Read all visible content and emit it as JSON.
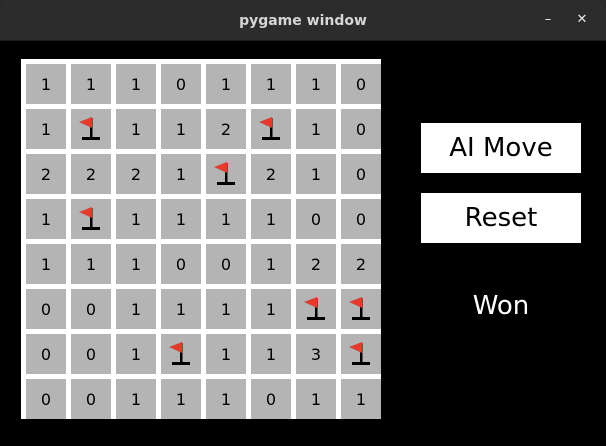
{
  "window": {
    "title": "pygame window",
    "minimize_glyph": "–",
    "close_glyph": "✕"
  },
  "board": {
    "rows": 8,
    "cols": 8,
    "cell_color": "#b4b4b4",
    "grid_color": "#ffffff",
    "flag_color": "#e8392b",
    "cells": [
      [
        "1",
        "1",
        "1",
        "0",
        "1",
        "1",
        "1",
        "0"
      ],
      [
        "1",
        "F",
        "1",
        "1",
        "2",
        "F",
        "1",
        "0"
      ],
      [
        "2",
        "2",
        "2",
        "1",
        "F",
        "2",
        "1",
        "0"
      ],
      [
        "1",
        "F",
        "1",
        "1",
        "1",
        "1",
        "0",
        "0"
      ],
      [
        "1",
        "1",
        "1",
        "0",
        "0",
        "1",
        "2",
        "2"
      ],
      [
        "0",
        "0",
        "1",
        "1",
        "1",
        "1",
        "F",
        "F"
      ],
      [
        "0",
        "0",
        "1",
        "F",
        "1",
        "1",
        "3",
        "F"
      ],
      [
        "0",
        "0",
        "1",
        "1",
        "1",
        "0",
        "1",
        "1"
      ]
    ]
  },
  "controls": {
    "ai_move_label": "AI Move",
    "reset_label": "Reset"
  },
  "status": {
    "text": "Won"
  }
}
